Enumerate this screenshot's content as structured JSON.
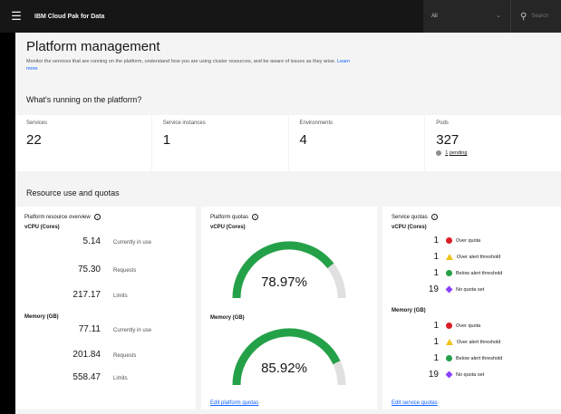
{
  "topbar": {
    "brand": "IBM Cloud Pak for Data",
    "scope": "All",
    "search_placeholder": "Search"
  },
  "header": {
    "title": "Platform management",
    "description": "Monitor the services that are running on the platform, understand how you are using cluster resources, and be aware of issues as they arise.",
    "learn_more": "Learn more"
  },
  "running": {
    "title": "What's running on the platform?",
    "tiles": [
      {
        "label": "Services",
        "value": "22"
      },
      {
        "label": "Service instances",
        "value": "1"
      },
      {
        "label": "Environments",
        "value": "4"
      },
      {
        "label": "Pods",
        "value": "327",
        "pending_count": "1",
        "pending_text": "pending"
      }
    ]
  },
  "resources": {
    "title": "Resource use and quotas",
    "overview": {
      "title": "Platform resource overview",
      "vcpu_label": "vCPU (Cores)",
      "vcpu": [
        {
          "value": "5.14",
          "label": "Currently in use"
        },
        {
          "value": "75.30",
          "label": "Requests"
        },
        {
          "value": "217.17",
          "label": "Limits"
        }
      ],
      "memory_label": "Memory (GB)",
      "memory": [
        {
          "value": "77.11",
          "label": "Currently in use"
        },
        {
          "value": "201.84",
          "label": "Requests"
        },
        {
          "value": "558.47",
          "label": "Limits"
        }
      ]
    },
    "platform_quotas": {
      "title": "Platform quotas",
      "vcpu_label": "vCPU (Cores)",
      "vcpu_percent": "78.97%",
      "vcpu_fraction": 0.7897,
      "memory_label": "Memory (GB)",
      "memory_percent": "85.92%",
      "memory_fraction": 0.8592,
      "edit_link": "Edit platform quotas",
      "gauge_color": "#24a148",
      "track_color": "#e0e0e0"
    },
    "service_quotas": {
      "title": "Service quotas",
      "vcpu_label": "vCPU (Cores)",
      "vcpu": [
        {
          "count": "1",
          "icon": "over-quota-icon",
          "label": "Over quota"
        },
        {
          "count": "1",
          "icon": "alert-threshold-icon",
          "label": "Over alert threshold"
        },
        {
          "count": "1",
          "icon": "below-threshold-icon",
          "label": "Below alert threshold"
        },
        {
          "count": "19",
          "icon": "no-quota-icon",
          "label": "No quota set"
        }
      ],
      "memory_label": "Memory (GB)",
      "memory": [
        {
          "count": "1",
          "icon": "over-quota-icon",
          "label": "Over quota"
        },
        {
          "count": "1",
          "icon": "alert-threshold-icon",
          "label": "Over alert threshold"
        },
        {
          "count": "1",
          "icon": "below-threshold-icon",
          "label": "Below alert threshold"
        },
        {
          "count": "19",
          "icon": "no-quota-icon",
          "label": "No quota set"
        }
      ],
      "edit_link": "Edit service quotas"
    }
  }
}
